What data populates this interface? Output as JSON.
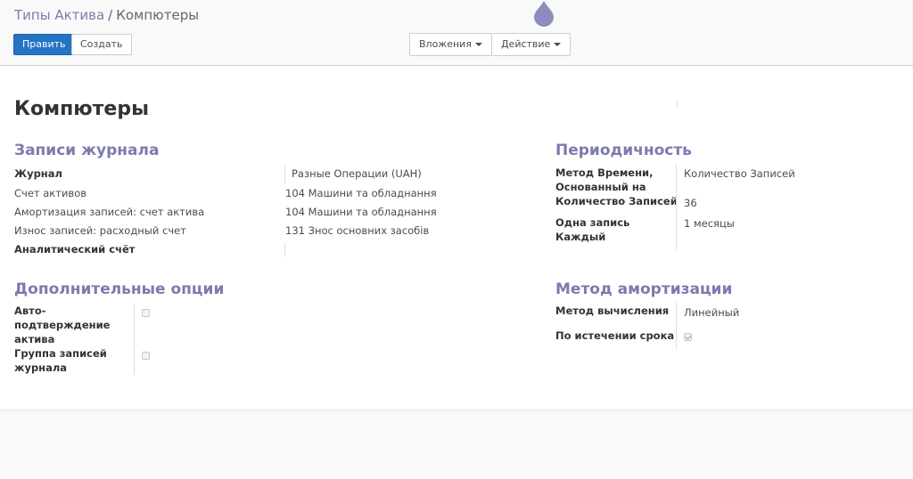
{
  "breadcrumb": {
    "parent": "Типы Актива",
    "separator": "/",
    "current": "Компютеры"
  },
  "toolbar": {
    "edit_label": "Править",
    "create_label": "Создать",
    "attachments_label": "Вложения",
    "action_label": "Действие"
  },
  "icons": {
    "drop": "drop-icon",
    "caret": "caret-down-icon"
  },
  "colors": {
    "primary": "#2473c5",
    "section_title": "#7c7bad"
  },
  "record": {
    "title": "Компютеры"
  },
  "journal": {
    "title": "Записи журнала",
    "fields": [
      {
        "label": "Журнал",
        "value": "Разные Операции (UAH)"
      },
      {
        "label": "Счет активов",
        "value": "104 Машини та обладнання"
      },
      {
        "label": "Амортизация записей: счет актива",
        "value": "104 Машини та обладнання"
      },
      {
        "label": "Износ записей: расходный счет",
        "value": "131 Знос основних засобів"
      },
      {
        "label": "Аналитический счёт",
        "value": ""
      }
    ]
  },
  "periodicity": {
    "title": "Периодичность",
    "time_method_label_1": "Метод Времени,",
    "time_method_label_2": "Основанный на",
    "time_method_label_3": "Количество Записей",
    "time_method_value": "Количество Записей",
    "entries_count": "36",
    "period_label_1": "Одна запись",
    "period_label_2": "Каждый",
    "period_value": "1 месяцы"
  },
  "options": {
    "title": "Дополнительные опции",
    "auto_confirm_label_1": "Авто-",
    "auto_confirm_label_2": "подтверждение",
    "auto_confirm_label_3": "актива",
    "auto_confirm_checked": false,
    "group_label_1": "Группа записей",
    "group_label_2": "журнала",
    "group_checked": false
  },
  "depreciation": {
    "title": "Метод амортизации",
    "method_label": "Метод вычисления",
    "method_value": "Линейный",
    "prorata_label": "По истечении срока",
    "prorata_checked": true
  }
}
